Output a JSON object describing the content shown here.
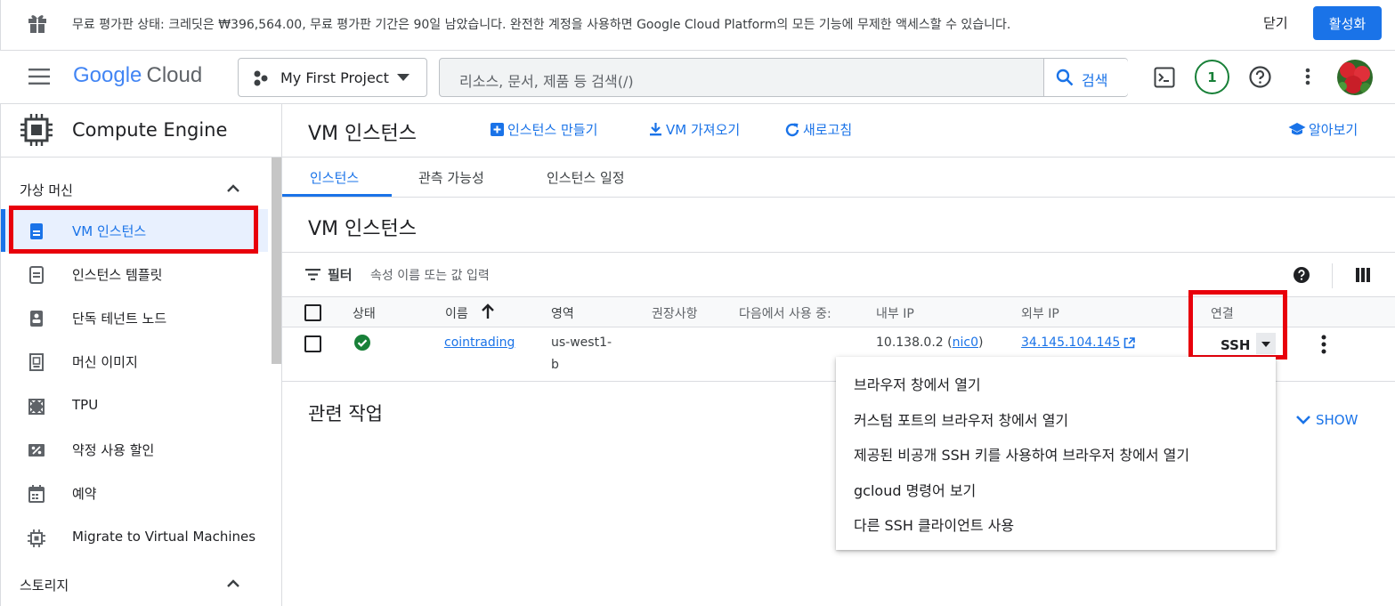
{
  "banner": {
    "message": "무료 평가판 상태: 크레딧은 ₩396,564.00, 무료 평가판 기간은 90일 남았습니다. 완전한 계정을 사용하면 Google Cloud Platform의 모든 기능에 무제한 액세스할 수 있습니다.",
    "close_label": "닫기",
    "activate_label": "활성화"
  },
  "header": {
    "logo_google": "Google",
    "logo_cloud": "Cloud",
    "project": "My First Project",
    "search_placeholder": "리소스, 문서, 제품 등 검색(/)",
    "search_button": "검색",
    "notification_count": "1"
  },
  "sidebar": {
    "product": "Compute Engine",
    "section_vm": "가상 머신",
    "items": [
      {
        "label": "VM 인스턴스",
        "icon": "vm-instance-icon",
        "active": true
      },
      {
        "label": "인스턴스 템플릿",
        "icon": "template-icon"
      },
      {
        "label": "단독 테넌트 노드",
        "icon": "sole-tenant-icon"
      },
      {
        "label": "머신 이미지",
        "icon": "machine-image-icon"
      },
      {
        "label": "TPU",
        "icon": "tpu-icon"
      },
      {
        "label": "약정 사용 할인",
        "icon": "discount-icon"
      },
      {
        "label": "예약",
        "icon": "calendar-icon"
      },
      {
        "label": "Migrate to Virtual Machines",
        "icon": "migrate-icon"
      }
    ],
    "section_storage": "스토리지"
  },
  "main": {
    "title": "VM 인스턴스",
    "actions": {
      "create": "인스턴스 만들기",
      "import": "VM 가져오기",
      "refresh": "새로고침",
      "learn": "알아보기"
    },
    "tabs": [
      "인스턴스",
      "관측 가능성",
      "인스턴스 일정"
    ],
    "section_title": "VM 인스턴스",
    "filter_label": "필터",
    "filter_placeholder": "속성 이름 또는 값 입력",
    "columns": [
      "상태",
      "이름",
      "영역",
      "권장사항",
      "다음에서 사용 중:",
      "내부 IP",
      "외부 IP",
      "연결"
    ],
    "row": {
      "name": "cointrading",
      "zone_line1": "us-west1-",
      "zone_line2": "b",
      "internal_ip": "10.138.0.2 (",
      "nic": "nic0",
      "internal_ip_end": ")",
      "external_ip": "34.145.104.145",
      "connect": "SSH"
    },
    "related_title": "관련 작업",
    "show_label": "SHOW"
  },
  "ssh_menu": [
    "브라우저 창에서 열기",
    "커스텀 포트의 브라우저 창에서 열기",
    "제공된 비공개 SSH 키를 사용하여 브라우저 창에서 열기",
    "gcloud 명령어 보기",
    "다른 SSH 클라이언트 사용"
  ],
  "colors": {
    "accent": "#1a73e8",
    "highlight": "#e8000b",
    "running": "#188038"
  }
}
